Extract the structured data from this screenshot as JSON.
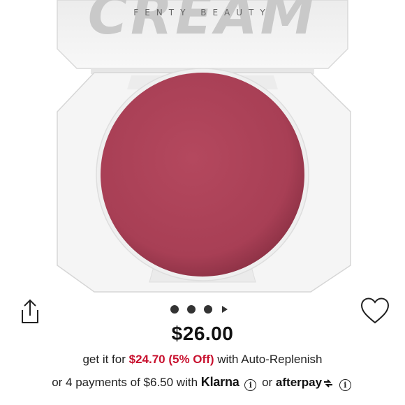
{
  "product_image": {
    "brand_text": "FENTY BEAUTY",
    "product_text": "CREAM"
  },
  "carousel": {
    "dot_count": 3,
    "has_play_control": true
  },
  "price": {
    "main": "$26.00"
  },
  "replenish": {
    "prefix": "get it for",
    "deal": "$24.70 (5% Off)",
    "suffix": "with Auto-Replenish"
  },
  "installments": {
    "prefix": "or 4 payments of $6.50 with",
    "klarna": "Klarna",
    "connector": "or",
    "afterpay": "afterpay"
  },
  "icons": {
    "share": "share-icon",
    "favorite": "heart-icon",
    "info": "info-icon"
  },
  "colors": {
    "blush": "#b2465c",
    "accent": "#c8102e",
    "compact": "#f4f4f4"
  }
}
